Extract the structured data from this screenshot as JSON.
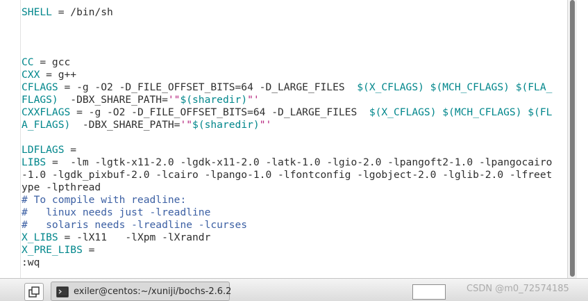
{
  "editor": {
    "lines": [
      [
        {
          "t": "SHELL",
          "c": "var"
        },
        {
          "t": " = /bin/sh",
          "c": ""
        }
      ],
      [],
      [],
      [],
      [
        {
          "t": "CC",
          "c": "var"
        },
        {
          "t": " = gcc",
          "c": ""
        }
      ],
      [
        {
          "t": "CXX",
          "c": "var"
        },
        {
          "t": " = g++",
          "c": ""
        }
      ],
      [
        {
          "t": "CFLAGS",
          "c": "var"
        },
        {
          "t": " = -g -O2 -D_FILE_OFFSET_BITS=64 -D_LARGE_FILES  ",
          "c": ""
        },
        {
          "t": "$(X_CFLAGS) $(MCH_CFLAGS) $(FLA_",
          "c": "mac"
        }
      ],
      [
        {
          "t": "FLAGS)",
          "c": "mac"
        },
        {
          "t": "  -DBX_SHARE_PATH=",
          "c": ""
        },
        {
          "t": "'\"",
          "c": "str"
        },
        {
          "t": "$(sharedir)",
          "c": "mac"
        },
        {
          "t": "\"'",
          "c": "str"
        }
      ],
      [
        {
          "t": "CXXFLAGS",
          "c": "var"
        },
        {
          "t": " = -g -O2 -D_FILE_OFFSET_BITS=64 -D_LARGE_FILES  ",
          "c": ""
        },
        {
          "t": "$(X_CFLAGS) $(MCH_CFLAGS) $(FL",
          "c": "mac"
        }
      ],
      [
        {
          "t": "A_FLAGS)",
          "c": "mac"
        },
        {
          "t": "  -DBX_SHARE_PATH=",
          "c": ""
        },
        {
          "t": "'\"",
          "c": "str"
        },
        {
          "t": "$(sharedir)",
          "c": "mac"
        },
        {
          "t": "\"'",
          "c": "str"
        }
      ],
      [],
      [
        {
          "t": "LDFLAGS",
          "c": "var"
        },
        {
          "t": " =",
          "c": ""
        }
      ],
      [
        {
          "t": "LIBS",
          "c": "var"
        },
        {
          "t": " =  -lm -lgtk-x11-2.0 -lgdk-x11-2.0 -latk-1.0 -lgio-2.0 -lpangoft2-1.0 -lpangocairo",
          "c": ""
        }
      ],
      [
        {
          "t": "-1.0 -lgdk_pixbuf-2.0 -lcairo -lpango-1.0 -lfontconfig -lgobject-2.0 -lglib-2.0 -lfreet",
          "c": ""
        }
      ],
      [
        {
          "t": "ype -lpthread",
          "c": ""
        }
      ],
      [
        {
          "t": "# To compile with readline:",
          "c": "cmt"
        }
      ],
      [
        {
          "t": "#   linux needs just -lreadline",
          "c": "cmt"
        }
      ],
      [
        {
          "t": "#   solaris needs -lreadline -lcurses",
          "c": "cmt"
        }
      ],
      [
        {
          "t": "X_LIBS",
          "c": "var"
        },
        {
          "t": " = -lX11   -lXpm -lXrandr",
          "c": ""
        }
      ],
      [
        {
          "t": "X_PRE_LIBS",
          "c": "var"
        },
        {
          "t": " =",
          "c": ""
        }
      ],
      [
        {
          "t": ":wq",
          "c": ""
        }
      ]
    ]
  },
  "taskbar": {
    "task_label": "exiler@centos:~/xuniji/bochs-2.6.2",
    "watermark": "CSDN @m0_72574185"
  },
  "colors": {
    "variable": "#00868b",
    "string": "#b5227c",
    "comment": "#3b5fa3",
    "text": "#2e2e2e"
  }
}
